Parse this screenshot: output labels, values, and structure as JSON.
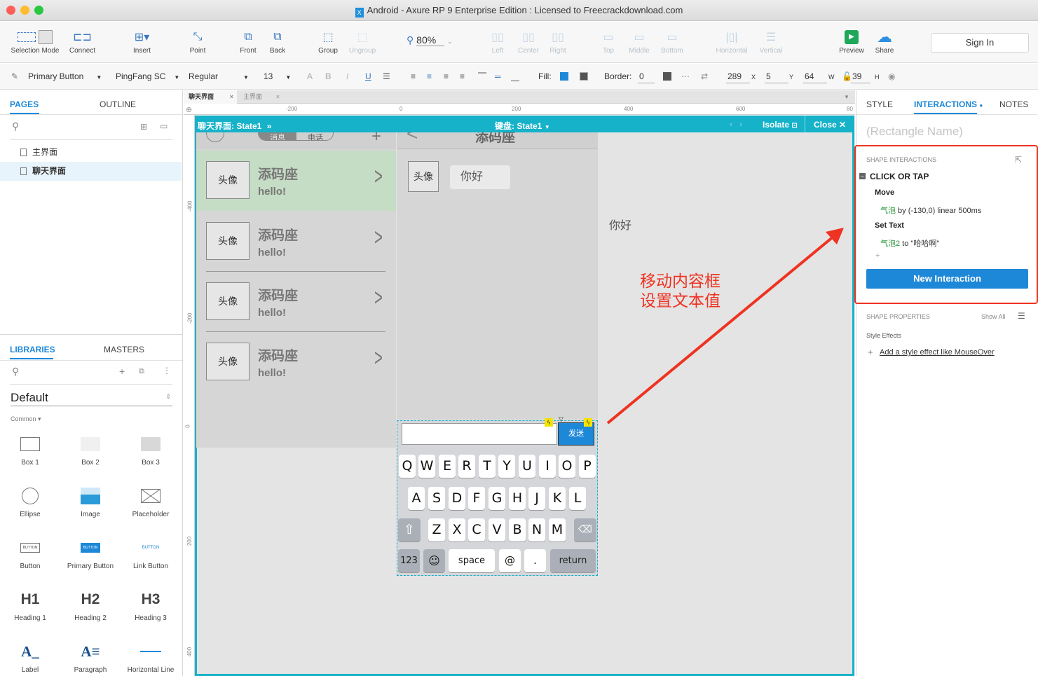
{
  "window": {
    "title": "Android - Axure RP 9 Enterprise Edition : Licensed to Freecrackdownload.com"
  },
  "toolbar": {
    "selection_mode": "Selection Mode",
    "connect": "Connect",
    "insert": "Insert",
    "point": "Point",
    "front": "Front",
    "back": "Back",
    "group": "Group",
    "ungroup": "Ungroup",
    "zoom": "80%",
    "left": "Left",
    "center": "Center",
    "right": "Right",
    "top": "Top",
    "middle": "Middle",
    "bottom": "Bottom",
    "horizontal": "Horizontal",
    "vertical": "Vertical",
    "preview": "Preview",
    "share": "Share",
    "sign_in": "Sign In"
  },
  "format": {
    "style": "Primary Button",
    "font": "PingFang SC",
    "weight": "Regular",
    "size": "13",
    "fill_label": "Fill:",
    "border_label": "Border:",
    "border_value": "0",
    "x": "289",
    "y": "5",
    "w": "64",
    "h": "39",
    "x_label": "X",
    "y_label": "Y",
    "w_label": "W",
    "h_label": "H"
  },
  "pages": {
    "tab_pages": "PAGES",
    "tab_outline": "OUTLINE",
    "items": [
      "主界面",
      "聊天界面"
    ]
  },
  "libraries": {
    "tab_libraries": "LIBRARIES",
    "tab_masters": "MASTERS",
    "selected": "Default",
    "group": "Common ▾",
    "items": [
      {
        "label": "Box 1"
      },
      {
        "label": "Box 2"
      },
      {
        "label": "Box 3"
      },
      {
        "label": "Ellipse"
      },
      {
        "label": "Image"
      },
      {
        "label": "Placeholder"
      },
      {
        "label": "Button"
      },
      {
        "label": "Primary Button"
      },
      {
        "label": "Link Button"
      },
      {
        "label": "Heading 1",
        "glyph": "H1"
      },
      {
        "label": "Heading 2",
        "glyph": "H2"
      },
      {
        "label": "Heading 3",
        "glyph": "H3"
      },
      {
        "label": "Label"
      },
      {
        "label": "Paragraph"
      },
      {
        "label": "Horizontal Line"
      }
    ],
    "button_glyph": "BUTTON"
  },
  "doc_tabs": [
    "聊天界面",
    "主界面"
  ],
  "ruler": {
    "h": [
      "-200",
      "0",
      "200",
      "400",
      "600",
      "80"
    ],
    "v": [
      "-400",
      "-200",
      "0",
      "200",
      "400"
    ]
  },
  "frame": {
    "left_state": "聊天界面: State1",
    "left_arrow": "»",
    "center_state": "键盘:  State1",
    "isolate": "Isolate",
    "close": "Close"
  },
  "chat": {
    "tab_msg": "消息",
    "tab_phone": "电话",
    "title": "添码座",
    "avatar": "头像",
    "contacts": [
      {
        "name": "添码座",
        "msg": "hello!"
      },
      {
        "name": "添码座",
        "msg": "hello!"
      },
      {
        "name": "添码座",
        "msg": "hello!"
      },
      {
        "name": "添码座",
        "msg": "hello!"
      }
    ],
    "bubble": "你好",
    "floating": "你好",
    "send": "发送"
  },
  "keyboard": {
    "row1": [
      "Q",
      "W",
      "E",
      "R",
      "T",
      "Y",
      "U",
      "I",
      "O",
      "P"
    ],
    "row2": [
      "A",
      "S",
      "D",
      "F",
      "G",
      "H",
      "J",
      "K",
      "L"
    ],
    "row3": [
      "Z",
      "X",
      "C",
      "V",
      "B",
      "N",
      "M"
    ],
    "k123": "123",
    "space": "space",
    "at": "@",
    "dot": ".",
    "ret": "return"
  },
  "annotation": {
    "line1": "移动内容框",
    "line2": "设置文本值"
  },
  "right": {
    "tab_style": "STYLE",
    "tab_interactions": "INTERACTIONS",
    "tab_notes": "NOTES",
    "shape_name_placeholder": "(Rectangle Name)",
    "shape_interactions": "SHAPE INTERACTIONS",
    "event": "CLICK OR TAP",
    "action1": "Move",
    "target1": "气泡",
    "detail1": " by (-130,0) linear 500ms",
    "action2": "Set Text",
    "target2": "气泡2",
    "detail2": " to \"哈哈啊\"",
    "plus": "+",
    "new_interaction": "New Interaction",
    "shape_properties": "SHAPE PROPERTIES",
    "show_all": "Show All",
    "style_effects": "Style Effects",
    "add_effect": "Add a style effect like MouseOver"
  },
  "colors": {
    "accent": "#1e88d8",
    "frame": "#15b2c9",
    "annotation": "#ee3322"
  }
}
